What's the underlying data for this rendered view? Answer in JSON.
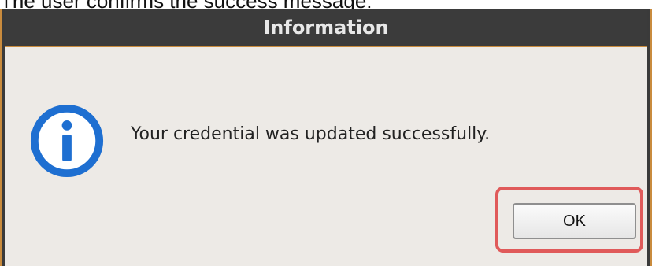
{
  "caption": "The user confirms the success message.",
  "dialog": {
    "title": "Information",
    "icon": "info-icon",
    "message": "Your credential was updated successfully.",
    "ok_label": "OK"
  },
  "colors": {
    "titlebar": "#3b3b3b",
    "dialog_bg": "#edeae6",
    "icon_blue": "#1e6fd1",
    "highlight_red": "#e05a5a"
  }
}
